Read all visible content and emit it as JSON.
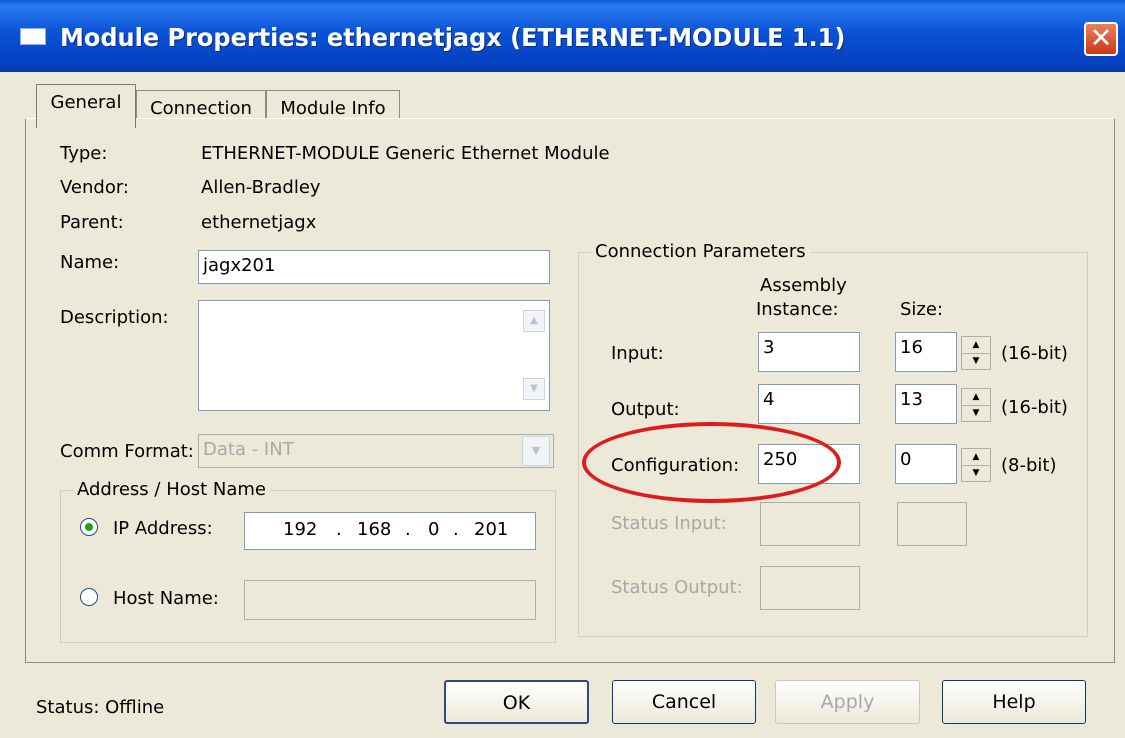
{
  "window": {
    "title": "Module Properties: ethernetjagx (ETHERNET-MODULE 1.1)",
    "close_icon": "close-icon"
  },
  "tabs": [
    {
      "label": "General"
    },
    {
      "label": "Connection"
    },
    {
      "label": "Module Info"
    }
  ],
  "general": {
    "type_label": "Type:",
    "type_value": "ETHERNET-MODULE Generic Ethernet Module",
    "vendor_label": "Vendor:",
    "vendor_value": "Allen-Bradley",
    "parent_label": "Parent:",
    "parent_value": "ethernetjagx",
    "name_label": "Name:",
    "name_value": "jagx201",
    "description_label": "Description:",
    "description_value": "",
    "comm_format_label": "Comm Format:",
    "comm_format_value": "Data - INT"
  },
  "address": {
    "legend": "Address / Host Name",
    "ip_label": "IP Address:",
    "ip_octets": [
      "192",
      "168",
      "0",
      "201"
    ],
    "ip_dot": ".",
    "host_label": "Host Name:",
    "host_value": "",
    "selected": "IP Address"
  },
  "connection_params": {
    "legend": "Connection Parameters",
    "col_assembly_line1": "Assembly",
    "col_assembly_line2": "Instance:",
    "col_size": "Size:",
    "rows": [
      {
        "label": "Input:",
        "instance": "3",
        "size": "16",
        "unit": "(16-bit)",
        "enabled": true
      },
      {
        "label": "Output:",
        "instance": "4",
        "size": "13",
        "unit": "(16-bit)",
        "enabled": true
      },
      {
        "label": "Configuration:",
        "instance": "250",
        "size": "0",
        "unit": "(8-bit)",
        "enabled": true
      },
      {
        "label": "Status Input:",
        "instance": "",
        "size": "",
        "unit": "",
        "enabled": false
      },
      {
        "label": "Status Output:",
        "instance": "",
        "size": "",
        "unit": "",
        "enabled": false
      }
    ],
    "highlight_color": "#e01b1b"
  },
  "footer": {
    "status_text": "Status:  Offline",
    "ok_label": "OK",
    "cancel_label": "Cancel",
    "apply_label": "Apply",
    "help_label": "Help"
  },
  "colors": {
    "title_bar": "#0a52d6",
    "dialog_bg": "#ece9d8",
    "disabled_text": "#a8a8a8"
  }
}
